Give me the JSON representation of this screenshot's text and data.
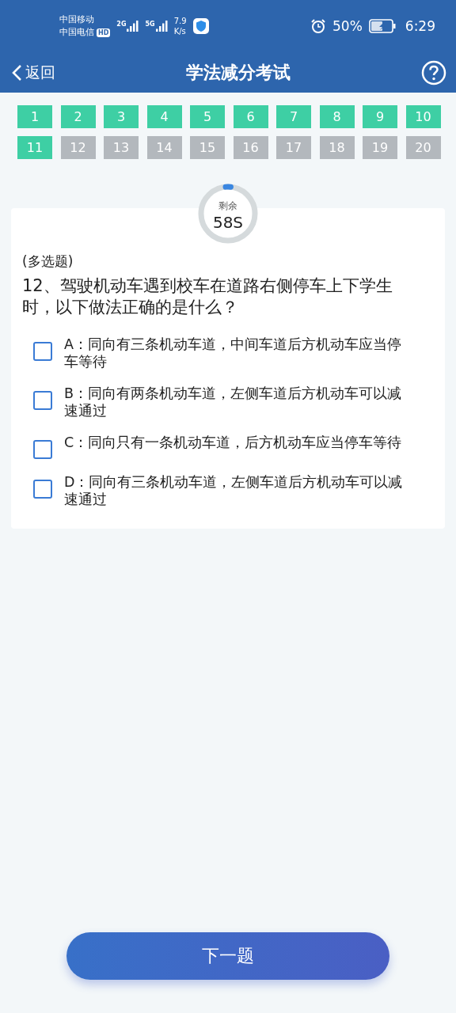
{
  "status_bar": {
    "carrier_1": "中国移动",
    "carrier_2": "中国电信",
    "hd": "HD",
    "net_1": "2G",
    "net_2": "5G",
    "speed_value": "7.9",
    "speed_unit": "K/s",
    "battery": "50%",
    "time": "6:29"
  },
  "nav": {
    "back": "返回",
    "title": "学法减分考试"
  },
  "questions": [
    {
      "number": "1",
      "answered": true
    },
    {
      "number": "2",
      "answered": true
    },
    {
      "number": "3",
      "answered": true
    },
    {
      "number": "4",
      "answered": true
    },
    {
      "number": "5",
      "answered": true
    },
    {
      "number": "6",
      "answered": true
    },
    {
      "number": "7",
      "answered": true
    },
    {
      "number": "8",
      "answered": true
    },
    {
      "number": "9",
      "answered": true
    },
    {
      "number": "10",
      "answered": true
    },
    {
      "number": "11",
      "answered": true
    },
    {
      "number": "12",
      "answered": false
    },
    {
      "number": "13",
      "answered": false
    },
    {
      "number": "14",
      "answered": false
    },
    {
      "number": "15",
      "answered": false
    },
    {
      "number": "16",
      "answered": false
    },
    {
      "number": "17",
      "answered": false
    },
    {
      "number": "18",
      "answered": false
    },
    {
      "number": "19",
      "answered": false
    },
    {
      "number": "20",
      "answered": false
    }
  ],
  "timer": {
    "label": "剩余",
    "value": "58S",
    "level": 0.03
  },
  "question": {
    "type": "(多选题)",
    "text": "12、驾驶机动车遇到校车在道路右侧停车上下学生时，以下做法正确的是什么？",
    "options": [
      {
        "text": "A：同向有三条机动车道，中间车道后方机动车应当停车等待",
        "checked": false
      },
      {
        "text": "B：同向有两条机动车道，左侧车道后方机动车可以减速通过",
        "checked": false
      },
      {
        "text": "C：同向只有一条机动车道，后方机动车应当停车等待",
        "checked": false
      },
      {
        "text": "D：同向有三条机动车道，左侧车道后方机动车可以减速通过",
        "checked": false
      }
    ]
  },
  "next_button": "下一题"
}
